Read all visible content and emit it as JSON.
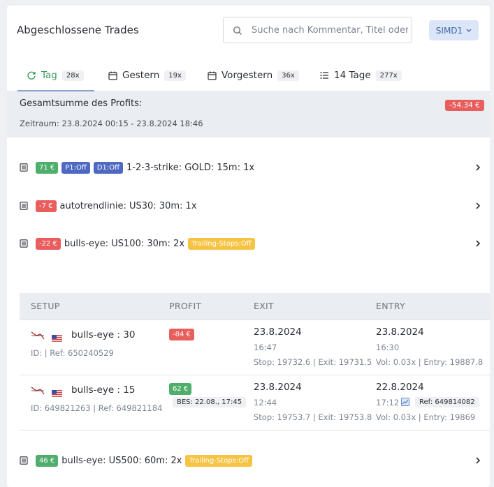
{
  "header": {
    "title": "Abgeschlossene Trades",
    "search_placeholder": "Suche nach Kommentar, Titel oder",
    "account": "SIMD1"
  },
  "tabs": [
    {
      "label": "Tag",
      "count": "28x",
      "icon": "refresh-icon",
      "active": true
    },
    {
      "label": "Gestern",
      "count": "19x",
      "icon": "calendar-icon"
    },
    {
      "label": "Vorgestern",
      "count": "36x",
      "icon": "calendar-icon"
    },
    {
      "label": "14 Tage",
      "count": "277x",
      "icon": "list-icon"
    }
  ],
  "summary": {
    "title": "Gesamtsumme des Profits:",
    "range": "Zeitraum: 23.8.2024 00:15 - 23.8.2024 18:46",
    "total": "-54.34 €"
  },
  "groups": [
    {
      "profit": "71 €",
      "profit_color": "green",
      "tags": [
        "P1:Off",
        "D1:Off"
      ],
      "label": "1-2-3-strike: GOLD: 15m: 1x"
    },
    {
      "profit": "-7 €",
      "profit_color": "red",
      "tags": [],
      "label": "autotrendlinie: US30: 30m: 1x"
    },
    {
      "profit": "-22 €",
      "profit_color": "red",
      "tags_after": [
        "Trailing-Stops:Off"
      ],
      "label": "bulls-eye: US100: 30m: 2x"
    },
    {
      "profit": "46 €",
      "profit_color": "green",
      "tags_after": [
        "Trailing-Stops:Off"
      ],
      "label": "bulls-eye: US500: 60m: 2x"
    }
  ],
  "table": {
    "headers": [
      "SETUP",
      "PROFIT",
      "EXIT",
      "ENTRY"
    ],
    "rows": [
      {
        "setup": "bulls-eye : 30",
        "ids": "ID: | Ref: 650240529",
        "profit": "-84 €",
        "exit_date": "23.8.2024",
        "exit_time": "16:47",
        "exit_detail": "Stop: 19732.6 | Exit: 19731.5",
        "entry_date": "23.8.2024",
        "entry_time": "16:30",
        "entry_detail": "Vol: 0.03x | Entry: 19887.8"
      },
      {
        "setup": "bulls-eye : 15",
        "ids": "ID: 649821263 | Ref: 649821184",
        "profit": "62 €",
        "bes": "BES: 22.08., 17:45",
        "exit_date": "23.8.2024",
        "exit_time": "12:44",
        "exit_detail": "Stop: 19753.7 | Exit: 19753.8",
        "entry_date": "22.8.2024",
        "entry_time": "17:12",
        "entry_ref": "Ref: 649814082",
        "entry_detail": "Vol: 0.03x | Entry: 19869"
      }
    ]
  },
  "colors": {
    "green": "#4fae6b",
    "red": "#ea5d5d",
    "blue": "#4d69c2",
    "yellow": "#f6c343",
    "accent": "#3f63a8"
  }
}
